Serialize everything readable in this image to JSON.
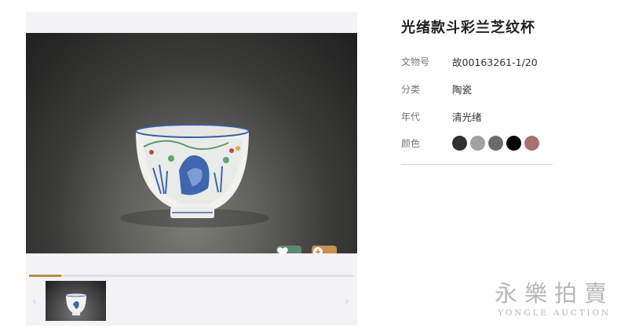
{
  "product": {
    "title": "光绪款斗彩兰芝纹杯",
    "fields": [
      {
        "label": "文物号",
        "value": "故00163261-1/20"
      },
      {
        "label": "分类",
        "value": "陶瓷"
      },
      {
        "label": "年代",
        "value": "清光绪"
      }
    ],
    "color_label": "颜色",
    "colors": [
      "#303030",
      "#a2a2a2",
      "#6a6a6a",
      "#050505",
      "#a87070"
    ]
  },
  "gallery": {
    "progress_fraction": 0.1,
    "prev_arrow": "‹",
    "next_arrow": "›",
    "icons": {
      "favorite": "heart-icon",
      "zoom": "zoom-in-icon"
    },
    "accent_favorite": "#5b8a70",
    "accent_zoom": "#c98f4b"
  },
  "watermark": {
    "chinese": "永樂拍賣",
    "english": "YONGLE AUCTION"
  }
}
